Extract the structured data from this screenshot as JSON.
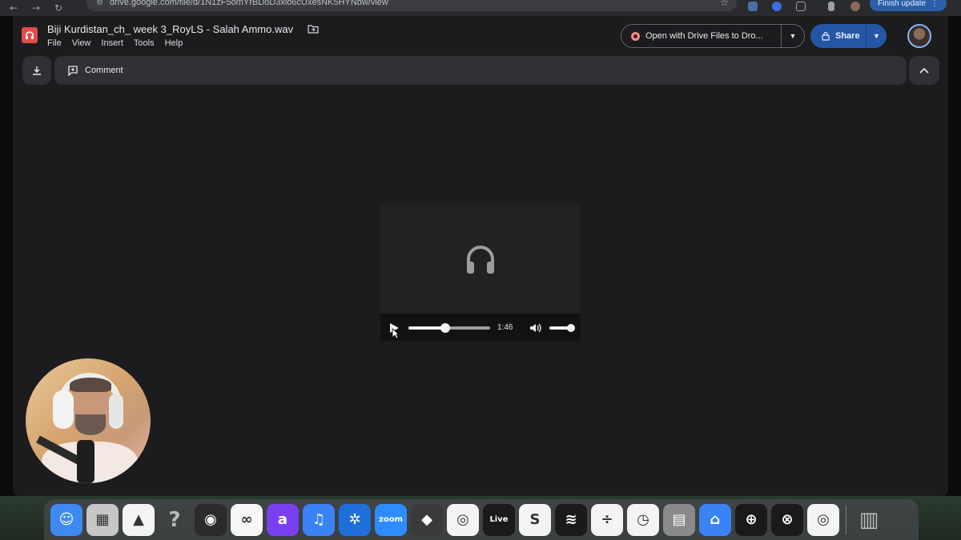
{
  "browser": {
    "url": "drive.google.com/file/d/1N1zF5omYrBDoD3xlo6cUxesNK5HYNbw/view",
    "finish_update_label": "Finish update"
  },
  "header": {
    "title": "Biji Kurdistan_ch_ week 3_RoyLS - Salah Ammo.wav",
    "menu": [
      "File",
      "View",
      "Insert",
      "Tools",
      "Help"
    ],
    "open_with_label": "Open with Drive Files to Dro...",
    "share_label": "Share"
  },
  "toolbar": {
    "comment_label": "Comment"
  },
  "player": {
    "duration": "1:46",
    "progress_fraction": 0.45,
    "volume_fraction": 0.9
  },
  "dock": {
    "items": [
      {
        "name": "finder",
        "color": "#3d8bf2",
        "glyph": "☺"
      },
      {
        "name": "launchpad",
        "color": "#c6c6c6",
        "glyph": "▦"
      },
      {
        "name": "google-drive",
        "color": "#f4f4f4",
        "glyph": "▲"
      },
      {
        "name": "help",
        "color": "transparent",
        "glyph": "?"
      },
      {
        "name": "obs",
        "color": "#2b2b2b",
        "glyph": "◉"
      },
      {
        "name": "loop-app",
        "color": "#f7f7f7",
        "glyph": "∞"
      },
      {
        "name": "arc-a",
        "color": "#7b3ff2",
        "glyph": "a"
      },
      {
        "name": "podcast",
        "color": "#3b82f6",
        "glyph": "♫"
      },
      {
        "name": "settings-gear",
        "color": "#1e6fd9",
        "glyph": "✲"
      },
      {
        "name": "zoom",
        "color": "#2d8cff",
        "glyph": "zoom"
      },
      {
        "name": "davinci",
        "color": "#3a3a3a",
        "glyph": "◆"
      },
      {
        "name": "chrome",
        "color": "#f4f4f4",
        "glyph": "◎"
      },
      {
        "name": "ableton-live",
        "color": "#1a1a1a",
        "glyph": "Live"
      },
      {
        "name": "s-app",
        "color": "#f4f4f4",
        "glyph": "S"
      },
      {
        "name": "spotify",
        "color": "#1a1a1a",
        "glyph": "≋"
      },
      {
        "name": "split-app",
        "color": "#f4f4f4",
        "glyph": "÷"
      },
      {
        "name": "clock",
        "color": "#f4f4f4",
        "glyph": "◷"
      },
      {
        "name": "calculator",
        "color": "#8a8a8a",
        "glyph": "▤"
      },
      {
        "name": "vpn",
        "color": "#3b82f6",
        "glyph": "⌂"
      },
      {
        "name": "audio-mixer",
        "color": "#1a1a1a",
        "glyph": "⊕"
      },
      {
        "name": "compass",
        "color": "#1a1a1a",
        "glyph": "⊗"
      },
      {
        "name": "chrome-alt",
        "color": "#f4f4f4",
        "glyph": "◎"
      },
      {
        "name": "trash",
        "color": "transparent",
        "glyph": "▥"
      }
    ]
  }
}
